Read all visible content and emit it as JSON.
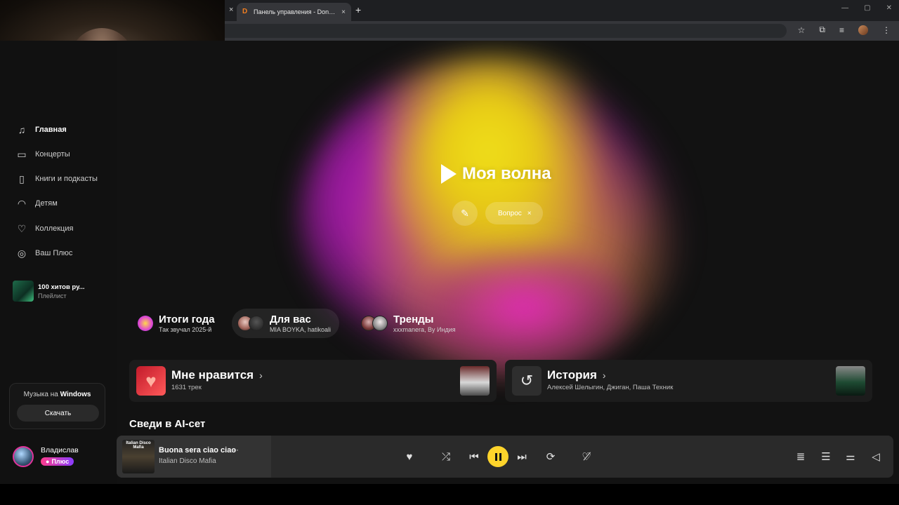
{
  "browser": {
    "tab_title": "Панель управления - Donatio",
    "tab_favicon": "D",
    "new_tab": "+",
    "close_glyph": "×"
  },
  "sidebar": {
    "items": [
      {
        "label": "Главная",
        "icon": "music-note-icon",
        "glyph": "♫"
      },
      {
        "label": "Концерты",
        "icon": "ticket-icon",
        "glyph": "▭"
      },
      {
        "label": "Книги и подкасты",
        "icon": "book-icon",
        "glyph": "▯"
      },
      {
        "label": "Детям",
        "icon": "kids-icon",
        "glyph": "◠"
      },
      {
        "label": "Коллекция",
        "icon": "heart-icon",
        "glyph": "♡"
      },
      {
        "label": "Ваш Плюс",
        "icon": "plus-icon",
        "glyph": "◎"
      }
    ],
    "playlist": {
      "title": "100 хитов ру...",
      "subtitle": "Плейлист"
    },
    "windows_card": {
      "text_prefix": "Музыка на ",
      "text_brand": "Windows",
      "button": "Скачать"
    },
    "user": {
      "name": "Владислав",
      "badge": "Плюс"
    }
  },
  "wave": {
    "title": "Моя волна",
    "chip_label": "Вопрос",
    "chip_close": "×",
    "pin_glyph": "✎"
  },
  "recs": [
    {
      "title": "Итоги года",
      "subtitle": "Так звучал 2025-й"
    },
    {
      "title": "Для вас",
      "subtitle": "MIA BOYKA, hatikoali"
    },
    {
      "title": "Тренды",
      "subtitle": "xxxmanera, By Индия"
    }
  ],
  "cards": [
    {
      "title": "Мне нравится",
      "subtitle": "1631 трек"
    },
    {
      "title": "История",
      "subtitle": "Алексей Шелыгин, Джиган, Паша Техник"
    }
  ],
  "section_title": "Сведи в AI-сет",
  "player": {
    "cover_text": "Italian Disco Mafia",
    "title": "Buona sera ciao ciao",
    "artist": "Italian Disco Mafia",
    "more": "···"
  },
  "colors": {
    "accent": "#fed42b",
    "plus_gradient_start": "#ff3c8c",
    "plus_gradient_end": "#8a3cff"
  }
}
